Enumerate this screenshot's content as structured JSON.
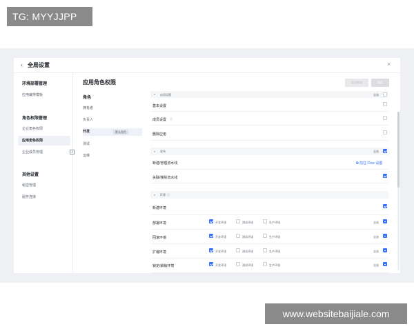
{
  "watermark": {
    "top": "TG: MYYJJPP",
    "bottom": "www.websitebaijiale.com"
  },
  "header": {
    "back_icon": "chevron-left-icon",
    "title": "全局设置",
    "close_icon": "close-icon"
  },
  "sidebar": {
    "groups": [
      {
        "title": "环境部署管理",
        "items": [
          {
            "label": "应用编排模板"
          }
        ]
      },
      {
        "title": "角色权限管理",
        "items": [
          {
            "label": "企业角色权限"
          },
          {
            "label": "应用角色权限"
          },
          {
            "label": "企业成员管理"
          }
        ]
      },
      {
        "title": "其他设置",
        "items": [
          {
            "label": "秘密管理"
          },
          {
            "label": "服务连接"
          }
        ]
      }
    ],
    "active_item": "应用角色权限"
  },
  "main": {
    "title": "应用角色权限",
    "buttons": {
      "cancel": "取消修改",
      "save": "保存"
    },
    "roles": {
      "heading": "角色",
      "items": [
        {
          "label": "拥有者"
        },
        {
          "label": "负责人"
        },
        {
          "label": "开发",
          "tag": "默认角色"
        },
        {
          "label": "测试"
        },
        {
          "label": "运维"
        }
      ],
      "active": "开发"
    },
    "permissions": {
      "select_all": "全选",
      "env_options": [
        "开发环境",
        "测试环境",
        "生产环境"
      ],
      "sections": [
        {
          "title": "应用设置",
          "rows": [
            {
              "label": "基本设置"
            },
            {
              "label": "成员设置"
            },
            {
              "label": "删除应用"
            }
          ]
        },
        {
          "title": "发布",
          "rows": [
            {
              "label": "新建/管理流水线",
              "link": "前往 Flow 设置"
            },
            {
              "label": "关联/移除流水线"
            }
          ]
        },
        {
          "title": "环境",
          "rows": [
            {
              "label": "新建环境"
            },
            {
              "label": "部署环境"
            },
            {
              "label": "回滚环境"
            },
            {
              "label": "扩缩环境"
            },
            {
              "label": "锁定/解锁环境"
            }
          ]
        }
      ]
    }
  }
}
